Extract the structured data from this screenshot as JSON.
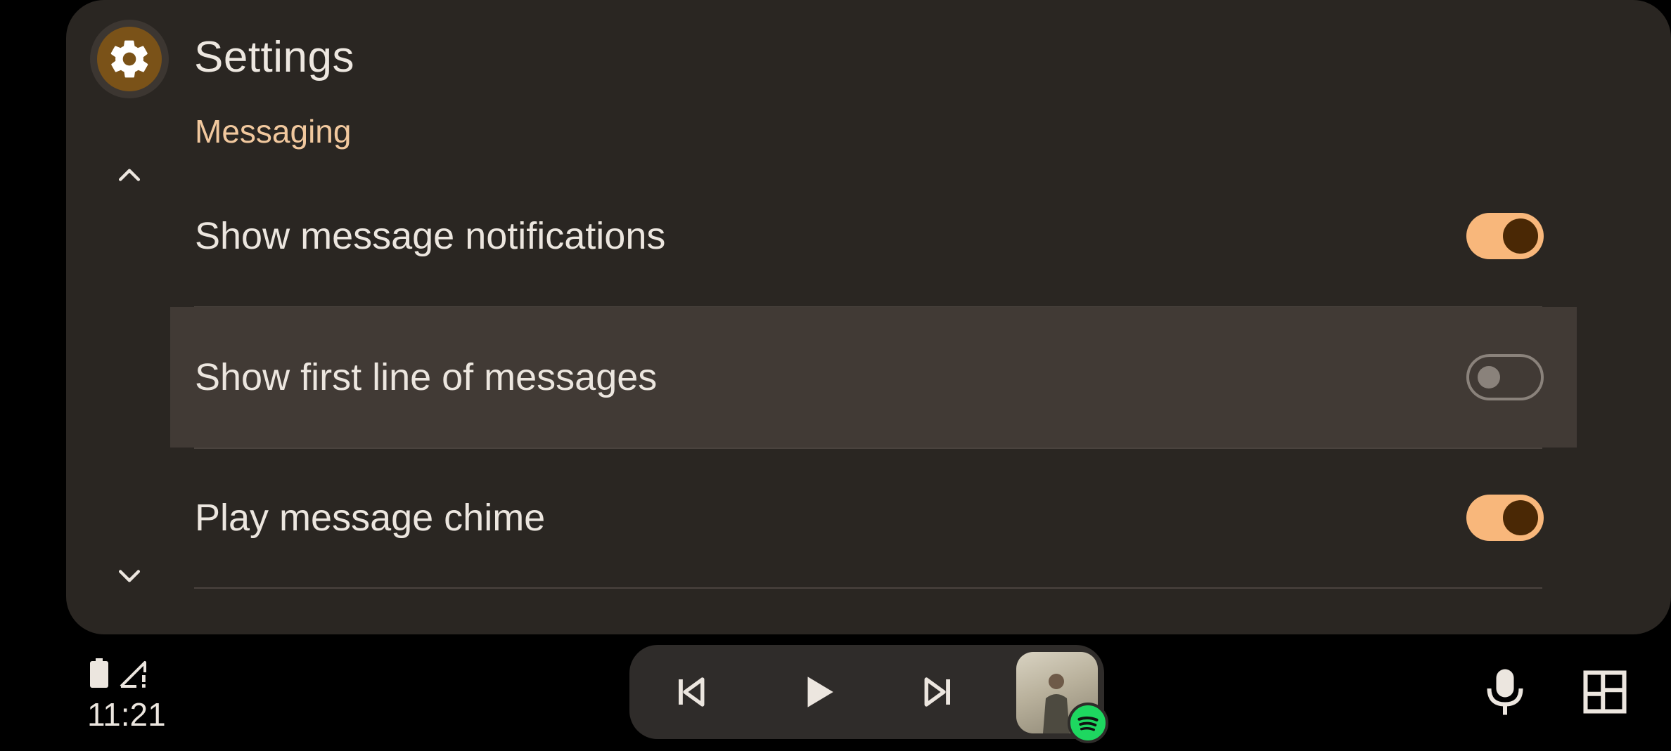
{
  "app": {
    "title": "Settings",
    "icon": "gear-icon"
  },
  "section": {
    "header": "Messaging"
  },
  "settings": [
    {
      "label": "Show message notifications",
      "enabled": true
    },
    {
      "label": "Show first line of messages",
      "enabled": false
    },
    {
      "label": "Play message chime",
      "enabled": true
    }
  ],
  "navigation": {
    "up_icon": "chevron-up-icon",
    "down_icon": "chevron-down-icon"
  },
  "status": {
    "time": "11:21",
    "battery_icon": "battery-icon",
    "signal_icon": "signal-no-service-icon"
  },
  "media": {
    "prev_icon": "skip-previous-icon",
    "play_icon": "play-icon",
    "next_icon": "skip-next-icon",
    "album_icon": "album-art-image",
    "source_icon": "spotify-icon"
  },
  "system": {
    "mic_icon": "microphone-icon",
    "layout_icon": "dashboard-layout-icon"
  },
  "colors": {
    "panel": "#2a2622",
    "accent": "#f8b77b",
    "section_header": "#f1c89e",
    "highlight_row": "#413a35"
  }
}
